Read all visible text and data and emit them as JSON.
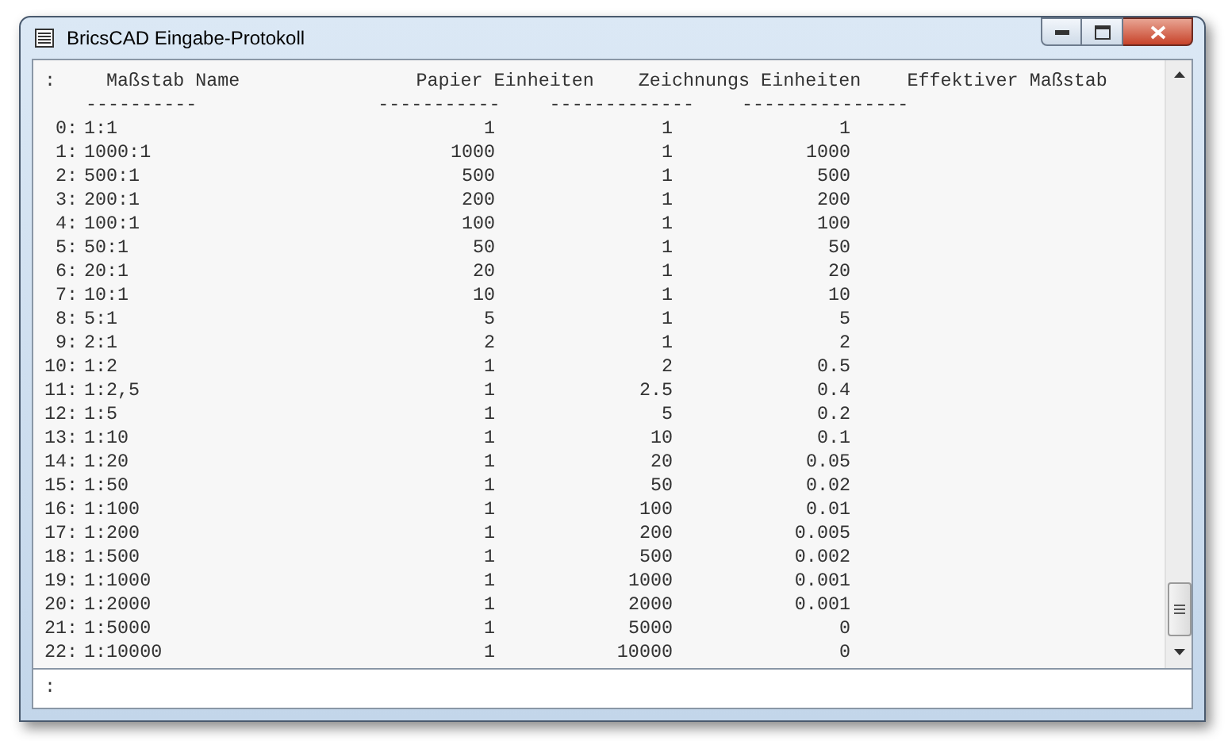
{
  "window": {
    "title": "BricsCAD Eingabe-Protokoll"
  },
  "header": {
    "prompt": ":",
    "columns": [
      "Maßstab Name",
      "Papier Einheiten",
      "Zeichnungs Einheiten",
      "Effektiver Maßstab"
    ],
    "underlines": [
      "----------",
      "-----------",
      "-------------",
      "---------------"
    ]
  },
  "rows": [
    {
      "index": "0:",
      "name": "1:1",
      "paper": "1",
      "drawing": "1",
      "effective": "1"
    },
    {
      "index": "1:",
      "name": "1000:1",
      "paper": "1000",
      "drawing": "1",
      "effective": "1000"
    },
    {
      "index": "2:",
      "name": "500:1",
      "paper": "500",
      "drawing": "1",
      "effective": "500"
    },
    {
      "index": "3:",
      "name": "200:1",
      "paper": "200",
      "drawing": "1",
      "effective": "200"
    },
    {
      "index": "4:",
      "name": "100:1",
      "paper": "100",
      "drawing": "1",
      "effective": "100"
    },
    {
      "index": "5:",
      "name": "50:1",
      "paper": "50",
      "drawing": "1",
      "effective": "50"
    },
    {
      "index": "6:",
      "name": "20:1",
      "paper": "20",
      "drawing": "1",
      "effective": "20"
    },
    {
      "index": "7:",
      "name": "10:1",
      "paper": "10",
      "drawing": "1",
      "effective": "10"
    },
    {
      "index": "8:",
      "name": "5:1",
      "paper": "5",
      "drawing": "1",
      "effective": "5"
    },
    {
      "index": "9:",
      "name": "2:1",
      "paper": "2",
      "drawing": "1",
      "effective": "2"
    },
    {
      "index": "10:",
      "name": "1:2",
      "paper": "1",
      "drawing": "2",
      "effective": "0.5"
    },
    {
      "index": "11:",
      "name": "1:2,5",
      "paper": "1",
      "drawing": "2.5",
      "effective": "0.4"
    },
    {
      "index": "12:",
      "name": "1:5",
      "paper": "1",
      "drawing": "5",
      "effective": "0.2"
    },
    {
      "index": "13:",
      "name": "1:10",
      "paper": "1",
      "drawing": "10",
      "effective": "0.1"
    },
    {
      "index": "14:",
      "name": "1:20",
      "paper": "1",
      "drawing": "20",
      "effective": "0.05"
    },
    {
      "index": "15:",
      "name": "1:50",
      "paper": "1",
      "drawing": "50",
      "effective": "0.02"
    },
    {
      "index": "16:",
      "name": "1:100",
      "paper": "1",
      "drawing": "100",
      "effective": "0.01"
    },
    {
      "index": "17:",
      "name": "1:200",
      "paper": "1",
      "drawing": "200",
      "effective": "0.005"
    },
    {
      "index": "18:",
      "name": "1:500",
      "paper": "1",
      "drawing": "500",
      "effective": "0.002"
    },
    {
      "index": "19:",
      "name": "1:1000",
      "paper": "1",
      "drawing": "1000",
      "effective": "0.001"
    },
    {
      "index": "20:",
      "name": "1:2000",
      "paper": "1",
      "drawing": "2000",
      "effective": "0.001"
    },
    {
      "index": "21:",
      "name": "1:5000",
      "paper": "1",
      "drawing": "5000",
      "effective": "0"
    },
    {
      "index": "22:",
      "name": "1:10000",
      "paper": "1",
      "drawing": "10000",
      "effective": "0"
    }
  ],
  "command_line": {
    "prompt": ":"
  }
}
